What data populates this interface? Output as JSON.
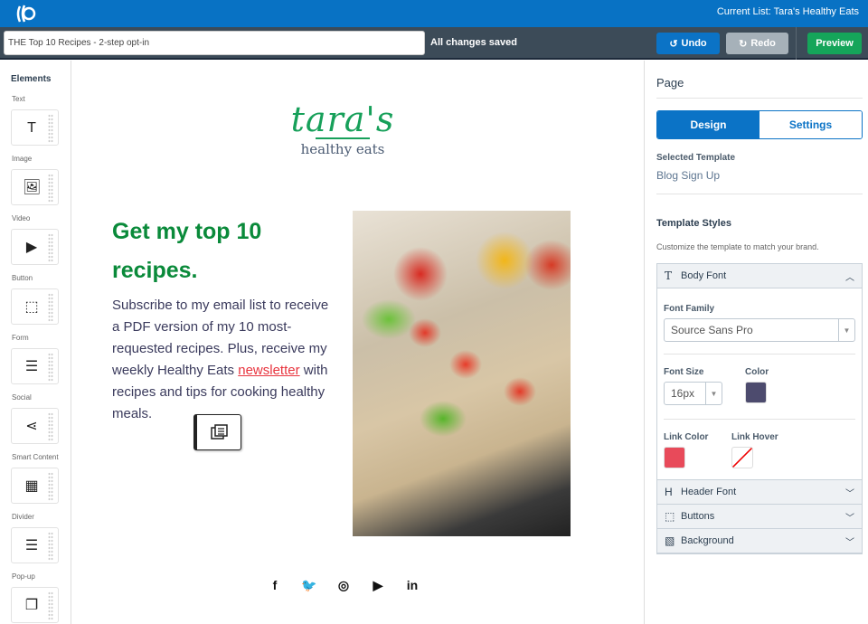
{
  "app": {
    "current_list": "Current List: Tara's Healthy Eats",
    "logo_icon": "aweber-logo-icon"
  },
  "toolbar": {
    "page_name": "THE Top 10 Recipes - 2-step opt-in",
    "status": "All changes saved",
    "undo": "Undo",
    "redo": "Redo",
    "preview": "Preview"
  },
  "elements": {
    "title": "Elements",
    "items": [
      {
        "label": "Text",
        "icon": "T"
      },
      {
        "label": "Image",
        "icon": "🖼"
      },
      {
        "label": "Video",
        "icon": "▶"
      },
      {
        "label": "Button",
        "icon": "⬚"
      },
      {
        "label": "Form",
        "icon": "☰"
      },
      {
        "label": "Social",
        "icon": "⋖"
      },
      {
        "label": "Smart Content",
        "icon": "▦"
      },
      {
        "label": "Divider",
        "icon": "☰"
      },
      {
        "label": "Pop-up",
        "icon": "❐"
      }
    ]
  },
  "canvas": {
    "brand_script": "tara's",
    "brand_sub": "healthy eats",
    "headline": "Get my top 10 recipes.",
    "body_before": "Subscribe to my email list to receive a PDF version of my 10 most-requested recipes. Plus, receive my weekly Healthy Eats ",
    "body_link": "newsletter",
    "body_after": " with recipes and tips for cooking healthy meals.",
    "social": [
      "f",
      "🐦",
      "◎",
      "▶",
      "in"
    ]
  },
  "panel": {
    "title": "Page",
    "tabs": [
      "Design",
      "Settings"
    ],
    "selected_template_label": "Selected Template",
    "selected_template": "Blog Sign Up",
    "template_styles": "Template Styles",
    "template_styles_desc": "Customize the template to match your brand.",
    "body_font": {
      "title": "Body Font",
      "font_family_label": "Font Family",
      "font_family": "Source Sans Pro",
      "font_size_label": "Font Size",
      "font_size": "16px",
      "color_label": "Color",
      "color": "#4d4b6e",
      "link_color_label": "Link Color",
      "link_color": "#e84a5a",
      "link_hover_label": "Link Hover",
      "link_hover": "none"
    },
    "sections": [
      "Header Font",
      "Buttons",
      "Background"
    ]
  }
}
